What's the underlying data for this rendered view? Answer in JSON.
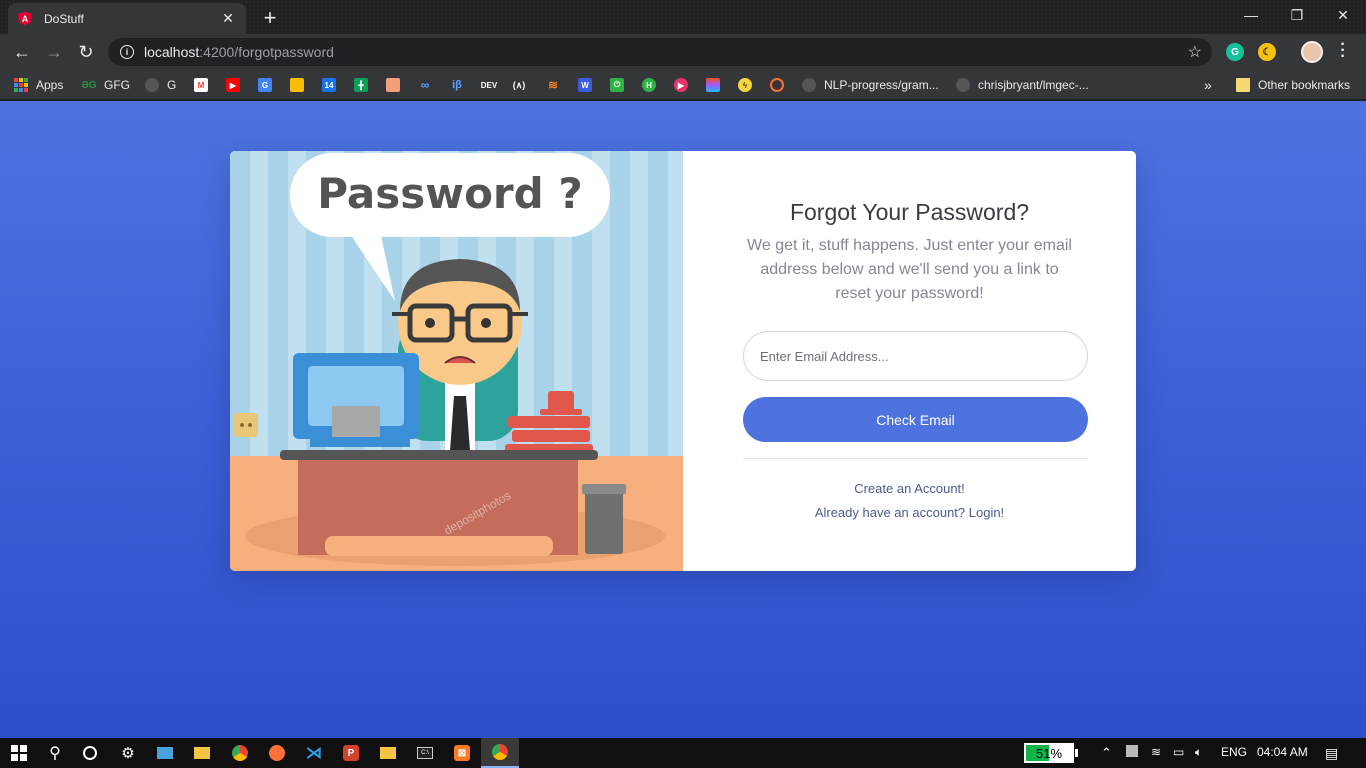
{
  "browser": {
    "tab": {
      "title": "DoStuff",
      "favicon": "angular-logo-icon"
    },
    "url": {
      "host": "localhost",
      "path": ":4200/forgotpassword"
    },
    "bookmarks": [
      {
        "label": "Apps",
        "icon": "apps-grid-icon"
      },
      {
        "label": "GFG",
        "icon": "gfg-icon"
      },
      {
        "label": "G",
        "icon": "github-icon"
      },
      {
        "label": "",
        "icon": "gmail-icon"
      },
      {
        "label": "",
        "icon": "youtube-icon"
      },
      {
        "label": "",
        "icon": "google-calendar-icon"
      },
      {
        "label": "",
        "icon": "google-keep-icon"
      },
      {
        "label": "",
        "icon": "calendar-14-icon"
      },
      {
        "label": "",
        "icon": "google-sheets-icon"
      },
      {
        "label": "",
        "icon": "hackerrank-icon"
      },
      {
        "label": "",
        "icon": "infinity-icon"
      },
      {
        "label": "",
        "icon": "interviewbit-icon"
      },
      {
        "label": "",
        "icon": "dev-icon"
      },
      {
        "label": "",
        "icon": "algolia-icon"
      },
      {
        "label": "",
        "icon": "stackoverflow-icon"
      },
      {
        "label": "",
        "icon": "app-icon"
      },
      {
        "label": "",
        "icon": "power-icon"
      },
      {
        "label": "",
        "icon": "hackerearth-icon"
      },
      {
        "label": "",
        "icon": "play-icon"
      },
      {
        "label": "",
        "icon": "figma-icon"
      },
      {
        "label": "",
        "icon": "bolt-icon"
      },
      {
        "label": "",
        "icon": "loop-icon"
      },
      {
        "label": "NLP-progress/gram...",
        "icon": "github-icon"
      },
      {
        "label": "chrisjbryant/lmgec-...",
        "icon": "github-icon"
      }
    ],
    "bookmarks_more": "»",
    "other_bookmarks": "Other bookmarks"
  },
  "page": {
    "illustration_text": "Password ?",
    "illustration_watermark": "depositphotos",
    "title": "Forgot Your Password?",
    "description": "We get it, stuff happens. Just enter your email address below and we'll send you a link to reset your password!",
    "email_placeholder": "Enter Email Address...",
    "email_value": "",
    "submit_label": "Check Email",
    "create_account_link": "Create an Account!",
    "login_link": "Already have an account? Login!"
  },
  "taskbar": {
    "battery_percent": "51%",
    "battery_level": 0.51,
    "language": "ENG",
    "time": "04:04 AM"
  },
  "colors": {
    "primary": "#4e73df",
    "page_gradient_top": "#4e73df",
    "page_gradient_bottom": "#2d4fca",
    "heading": "#3a3b45",
    "muted_text": "#858796",
    "battery_fill": "#12b34a"
  }
}
